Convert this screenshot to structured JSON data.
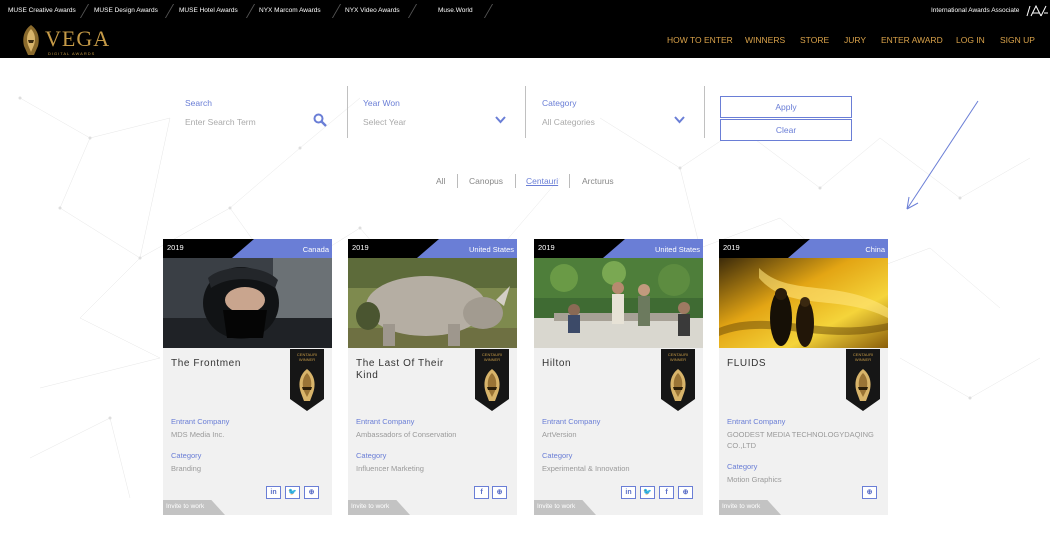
{
  "topbar": {
    "links": [
      "MUSE Creative Awards",
      "MUSE Design Awards",
      "MUSE Hotel Awards",
      "NYX Marcom Awards",
      "NYX Video Awards",
      "Muse.World"
    ],
    "right_label": "International Awards Associate"
  },
  "header": {
    "logo_text": "VEGA",
    "logo_sub": "DIGITAL AWARDS",
    "nav": [
      "HOW TO ENTER",
      "WINNERS",
      "STORE",
      "JURY",
      "ENTER AWARD",
      "LOG IN",
      "SIGN UP"
    ],
    "accent": "#d9a24a"
  },
  "filters": {
    "search_label": "Search",
    "search_placeholder": "Enter Search Term",
    "year_label": "Year Won",
    "year_value": "Select Year",
    "category_label": "Category",
    "category_value": "All Categories",
    "apply_label": "Apply",
    "clear_label": "Clear"
  },
  "tabs": {
    "items": [
      "All",
      "Canopus",
      "Centauri",
      "Arcturus"
    ],
    "active": "Centauri"
  },
  "colors": {
    "primary": "#6a7ed6",
    "card_bg": "#f1f1f1"
  },
  "card_labels": {
    "entrant": "Entrant Company",
    "category": "Category",
    "invite": "Invite to work",
    "badge_line1": "CENTAURI",
    "badge_line2": "WINNER"
  },
  "cards": [
    {
      "year": "2019",
      "country": "Canada",
      "title": "The Frontmen",
      "company": "MDS Media Inc.",
      "category": "Branding",
      "social": [
        "linkedin-icon",
        "twitter-icon",
        "globe-icon"
      ]
    },
    {
      "year": "2019",
      "country": "United States",
      "title": "The Last Of Their Kind",
      "company": "Ambassadors of Conservation",
      "category": "Influencer Marketing",
      "social": [
        "facebook-icon",
        "globe-icon"
      ]
    },
    {
      "year": "2019",
      "country": "United States",
      "title": "Hilton",
      "company": "ArtVersion",
      "category": "Experimental & Innovation",
      "social": [
        "linkedin-icon",
        "twitter-icon",
        "facebook-icon",
        "globe-icon"
      ]
    },
    {
      "year": "2019",
      "country": "China",
      "title": "FLUIDS",
      "company": "GOODEST MEDIA TECHNOLOGYDAQING CO.,LTD",
      "category": "Motion Graphics",
      "social": [
        "globe-icon"
      ]
    }
  ]
}
